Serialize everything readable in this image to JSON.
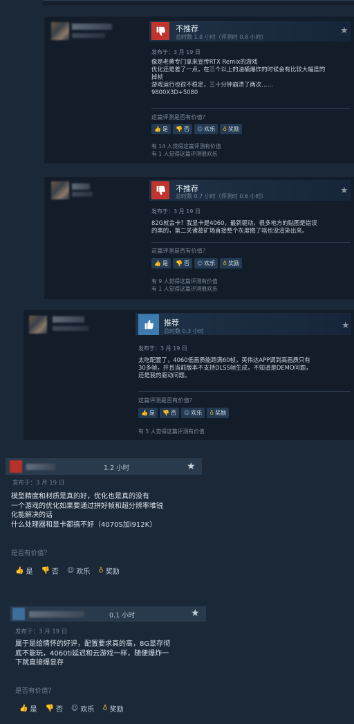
{
  "reviews": [
    {
      "verdict": "不推荐",
      "hours": "总时数 1.8 小时（评测时 0.8 小时）",
      "posted": "发布于：3 月 19 日",
      "body": [
        "像是老黄专门拿来宣传RTX Remix的游戏",
        "优化还是差了一点，在三个以上的油桶爆炸的时候会有比较大幅度的",
        "掉帧",
        "游戏运行也很不稳定，三十分钟崩溃了两次……",
        "9800X3D+5080"
      ],
      "helpful_q": "这篇评测是否有价值？",
      "stats": [
        "有 14 人觉得这篇评测有价值",
        "有 1 人觉得这篇评测很欢乐"
      ]
    },
    {
      "verdict": "不推荐",
      "hours": "总时数 0.7 小时（评测时 0.6 小时）",
      "posted": "发布于：3 月 19 日",
      "body": [
        "82G就会卡？我显卡是4060，最新驱动，很多地方的贴图是错误",
        "的黑的，第二关诸葛矿场直接整个灰度图了啥也没渲染出来。"
      ],
      "helpful_q": "这篇评测是否有价值？",
      "stats": [
        "有 9 人觉得这篇评测有价值",
        "有 1 人觉得这篇评测很欢乐"
      ]
    },
    {
      "verdict": "推荐",
      "hours": "总时数 0.3 小时",
      "posted": "发布于：3 月 19 日",
      "body": [
        "太吃配置了，4060低画质能跑满60帧，英伟达APP调到高画质只有",
        "30多帧，并且当前版本不支持DLSS帧生成，不知道是DEMO问题，",
        "还是我的驱动问题。"
      ],
      "helpful_q": "这篇评测是否有价值？",
      "stats": [
        "有 5 人觉得这篇评测有价值"
      ]
    }
  ],
  "compact_reviews": [
    {
      "hours": "1.2 小时",
      "posted": "发布于：3 月 19 日",
      "body": [
        "模型精度和材质是真的好，优化也是真的没有",
        "一个游戏的优化如果要通过拼好帧和超分辨率堆锐",
        "化能解决的话",
        "什么处理器和显卡都搞不好（4070S加i912K）"
      ],
      "helpful_q": "是否有价值？"
    },
    {
      "hours": "0.1 小时",
      "posted": "发布于：3 月 19 日",
      "body": [
        "属于是给情怀的好评，配置要求真的高，8G显存彻",
        "底不能玩，4060ti延迟和云游戏一样，随便爆炸一",
        "下就直接爆显存"
      ],
      "helpful_q": "是否有价值？"
    }
  ],
  "buttons": {
    "yes": "是",
    "no": "否",
    "funny": "欢乐",
    "award": "奖励"
  },
  "icons": {
    "yes": "thumbs-up-icon",
    "no": "thumbs-down-icon",
    "funny": "smiley-icon",
    "award": "award-icon",
    "star": "star-icon"
  },
  "colors": {
    "negative": "#c1352e",
    "positive": "#3e7bb0",
    "award": "#e2b632"
  }
}
